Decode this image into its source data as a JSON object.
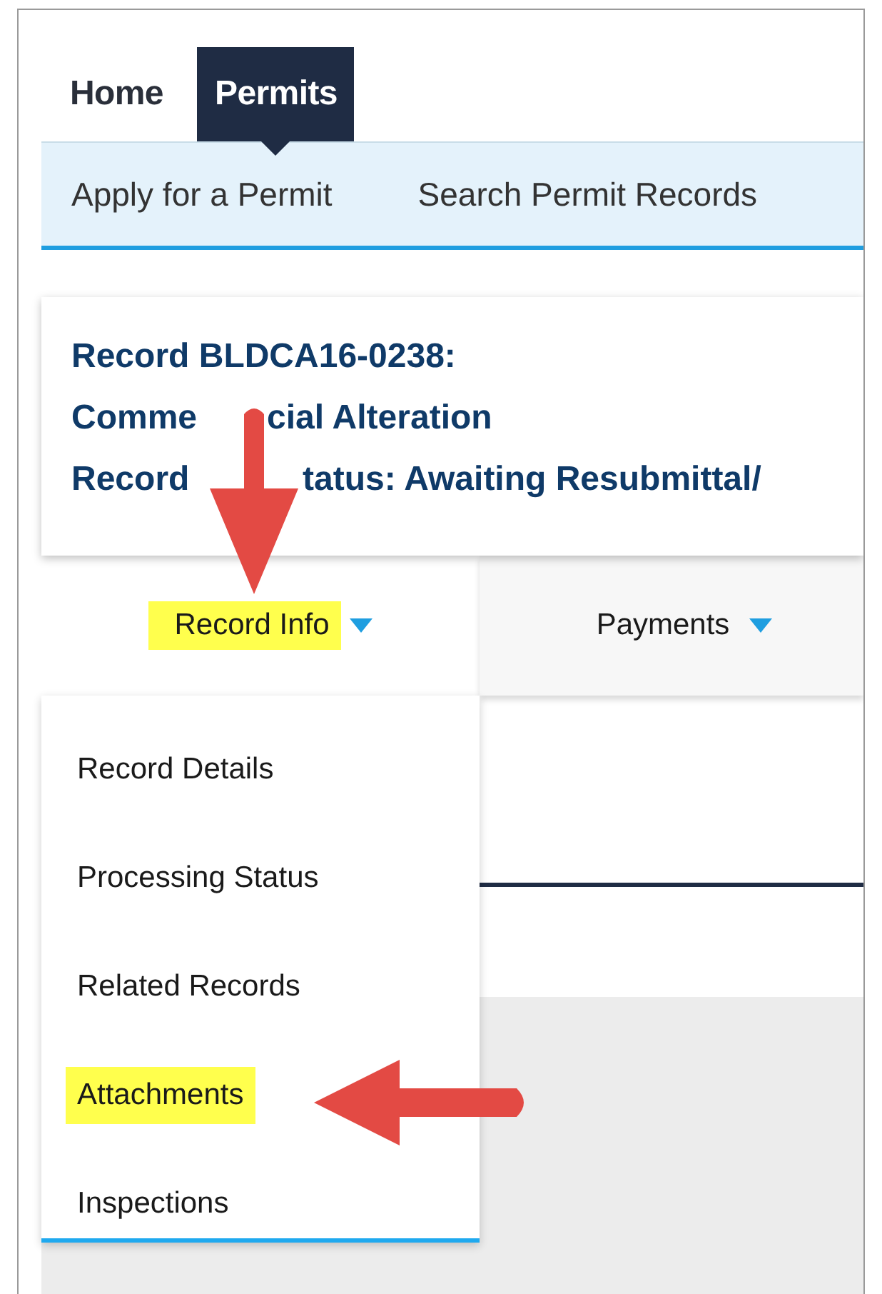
{
  "nav": {
    "tabs": [
      {
        "label": "Home",
        "selected": false
      },
      {
        "label": "Permits",
        "selected": true
      }
    ]
  },
  "subnav": {
    "links": [
      "Apply for a Permit",
      "Search Permit Records"
    ]
  },
  "record": {
    "title_lines": [
      [
        "Record BLDCA16-0238:"
      ],
      [
        "Comme",
        "cial Alteration"
      ],
      [
        "Record",
        "tatus: Awaiting Resubmittal/"
      ]
    ]
  },
  "record_tabs": [
    {
      "label": "Record Info",
      "selected": true,
      "highlighted": true
    },
    {
      "label": "Payments",
      "selected": false,
      "highlighted": false
    }
  ],
  "menu": {
    "items": [
      {
        "label": "Record Details",
        "highlighted": false
      },
      {
        "label": "Processing Status",
        "highlighted": false
      },
      {
        "label": "Related Records",
        "highlighted": false
      },
      {
        "label": "Attachments",
        "highlighted": true
      },
      {
        "label": "Inspections",
        "highlighted": false
      }
    ]
  },
  "annotations": [
    {
      "kind": "arrow-down"
    },
    {
      "kind": "arrow-left"
    }
  ]
}
